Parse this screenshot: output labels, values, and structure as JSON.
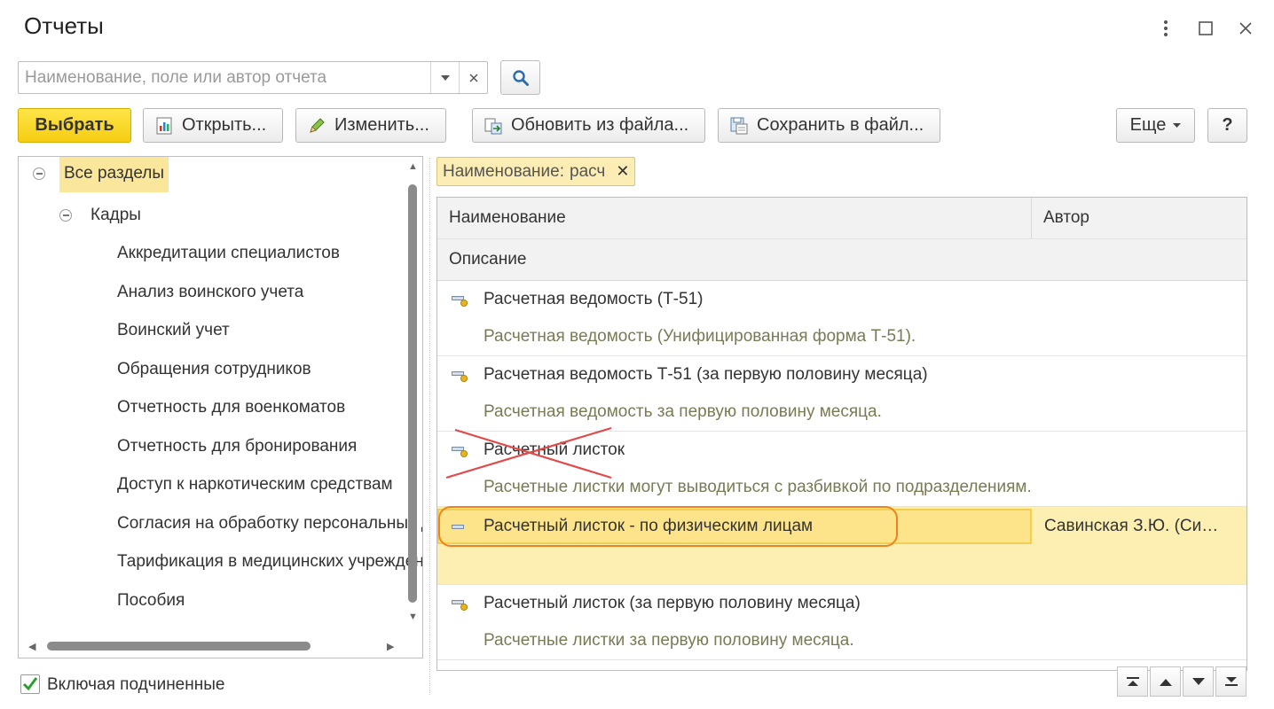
{
  "window": {
    "title": "Отчеты"
  },
  "search": {
    "placeholder": "Наименование, поле или автор отчета",
    "value": ""
  },
  "toolbar": {
    "select": "Выбрать",
    "open": "Открыть...",
    "edit": "Изменить...",
    "update_from_file": "Обновить из файла...",
    "save_to_file": "Сохранить в файл...",
    "more": "Еще",
    "help": "?"
  },
  "tree": {
    "root": "Все разделы",
    "group": "Кадры",
    "items": [
      "Аккредитации специалистов",
      "Анализ воинского учета",
      "Воинский учет",
      "Обращения сотрудников",
      "Отчетность для военкоматов",
      "Отчетность для бронирования",
      "Доступ к наркотическим средствам",
      "Согласия на обработку персональных данных",
      "Тарификация в медицинских учреждениях",
      "Пособия"
    ]
  },
  "include_subordinate": {
    "label": "Включая подчиненные",
    "checked": true
  },
  "filter_chip": {
    "label": "Наименование:",
    "value": "расч"
  },
  "table": {
    "columns": {
      "name": "Наименование",
      "author": "Автор",
      "description": "Описание"
    },
    "rows": [
      {
        "name": "Расчетная ведомость (Т-51)",
        "description": "Расчетная ведомость (Унифицированная форма Т-51).",
        "author": "",
        "icon": "report-option-icon",
        "crossed_out": false,
        "selected": false
      },
      {
        "name": "Расчетная ведомость Т-51 (за первую половину месяца)",
        "description": "Расчетная ведомость за первую половину месяца.",
        "author": "",
        "icon": "report-option-icon",
        "crossed_out": false,
        "selected": false
      },
      {
        "name": "Расчетный листок",
        "description": "Расчетные листки могут выводиться с разбивкой по подразделениям.",
        "author": "",
        "icon": "report-option-icon",
        "crossed_out": true,
        "selected": false
      },
      {
        "name": "Расчетный листок - по физическим лицам",
        "description": "",
        "author": "Савинская З.Ю. (Си…",
        "icon": "user-report-icon",
        "crossed_out": false,
        "selected": true,
        "highlighted": true
      },
      {
        "name": "Расчетный листок (за первую половину месяца)",
        "description": "Расчетные листки за первую половину месяца.",
        "author": "",
        "icon": "report-option-icon",
        "crossed_out": false,
        "selected": false
      }
    ]
  },
  "colors": {
    "accent_yellow": "#f5cd11",
    "selection": "#fcefb1",
    "highlight_outline": "#f0821e",
    "cross_mark": "#e04a4a"
  }
}
